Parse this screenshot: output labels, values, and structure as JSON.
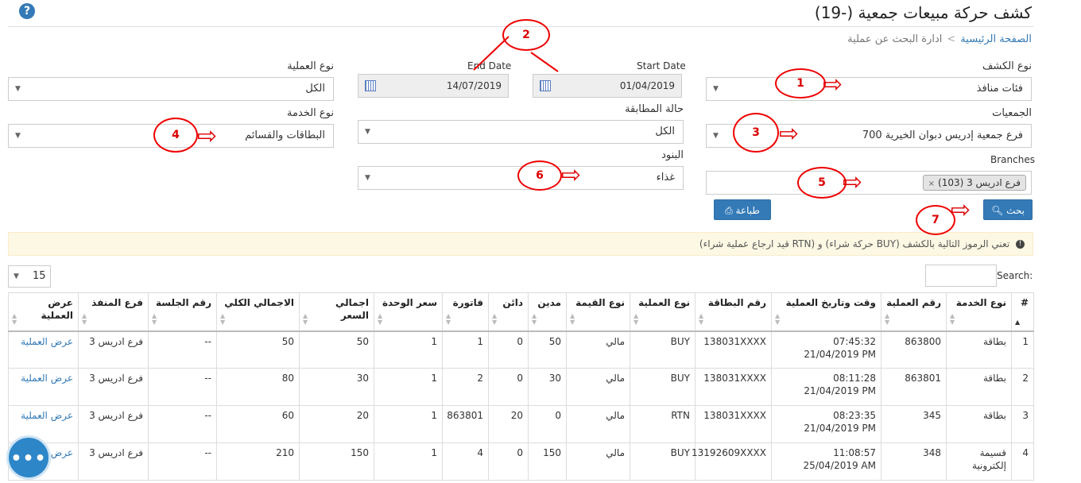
{
  "header": {
    "title": "كشف حركة مبيعات جمعية (-19)",
    "help_icon": "question-icon"
  },
  "breadcrumb": {
    "home": "الصفحة الرئيسية",
    "separator": ">",
    "current": "ادارة البحث عن عملية"
  },
  "form": {
    "report_type": {
      "label": "نوع الكشف",
      "value": "فئات منافذ"
    },
    "start_date": {
      "label": "Start Date",
      "value": "01/04/2019"
    },
    "end_date": {
      "label": "End Date",
      "value": "14/07/2019"
    },
    "operation_type": {
      "label": "نوع العملية",
      "value": "الكل"
    },
    "associations": {
      "label": "الجمعيات",
      "value": "فرع جمعية إدريس دبوان الخيرية 700"
    },
    "matching_status": {
      "label": "حالة المطابقة",
      "value": "الكل"
    },
    "service_type": {
      "label": "نوع الخدمة",
      "value": "البطاقات والقسائم"
    },
    "items": {
      "label": "البنود",
      "value": "غذاء"
    },
    "branches": {
      "label": "Branches",
      "tag": "فرع ادريس 3 (103)",
      "tag_remove": "×"
    },
    "search_button": "بحث",
    "print_button": "طباعة"
  },
  "notice": {
    "text": "تعني الرموز التالية بالكشف (BUY حركة شراء) و (RTN قيد ارجاع عملية شراء)"
  },
  "table_controls": {
    "page_size": "15",
    "search_label": "Search:"
  },
  "table": {
    "columns": [
      "#",
      "نوع الخدمة",
      "رقم العملية",
      "وقت وتاريخ العملية",
      "رقم البطاقة",
      "نوع العملية",
      "نوع القيمة",
      "مدين",
      "دائن",
      "فاتورة",
      "سعر الوحدة",
      "اجمالي السعر",
      "الاجمالي الكلي",
      "رقم الجلسة",
      "فرع المنفذ",
      "عرض العملية"
    ],
    "rows": [
      [
        "1",
        "بطاقة",
        "863800",
        "07:45:32 21/04/2019 PM",
        "138031XXXX",
        "BUY",
        "مالي",
        "50",
        "0",
        "1",
        "1",
        "50",
        "50",
        "--",
        "فرع ادريس 3",
        "عرض العملية"
      ],
      [
        "2",
        "بطاقة",
        "863801",
        "08:11:28 21/04/2019 PM",
        "138031XXXX",
        "BUY",
        "مالي",
        "30",
        "0",
        "2",
        "1",
        "30",
        "80",
        "--",
        "فرع ادريس 3",
        "عرض العملية"
      ],
      [
        "3",
        "بطاقة",
        "345",
        "08:23:35 21/04/2019 PM",
        "138031XXXX",
        "RTN",
        "مالي",
        "0",
        "20",
        "863801",
        "1",
        "20",
        "60",
        "--",
        "فرع ادريس 3",
        "عرض العملية"
      ],
      [
        "4",
        "قسيمة إلكترونية",
        "348",
        "11:08:57 25/04/2019 AM",
        "13192609XXXX",
        "BUY",
        "مالي",
        "150",
        "0",
        "4",
        "1",
        "150",
        "210",
        "--",
        "فرع ادريس 3",
        "عرض"
      ]
    ]
  },
  "annotations": [
    "1",
    "2",
    "3",
    "4",
    "5",
    "6",
    "7"
  ],
  "chat": {
    "dots": "•••"
  },
  "colors": {
    "accent": "#337ab7",
    "annotation": "#e00000",
    "notice_bg": "#fcf8e3"
  }
}
